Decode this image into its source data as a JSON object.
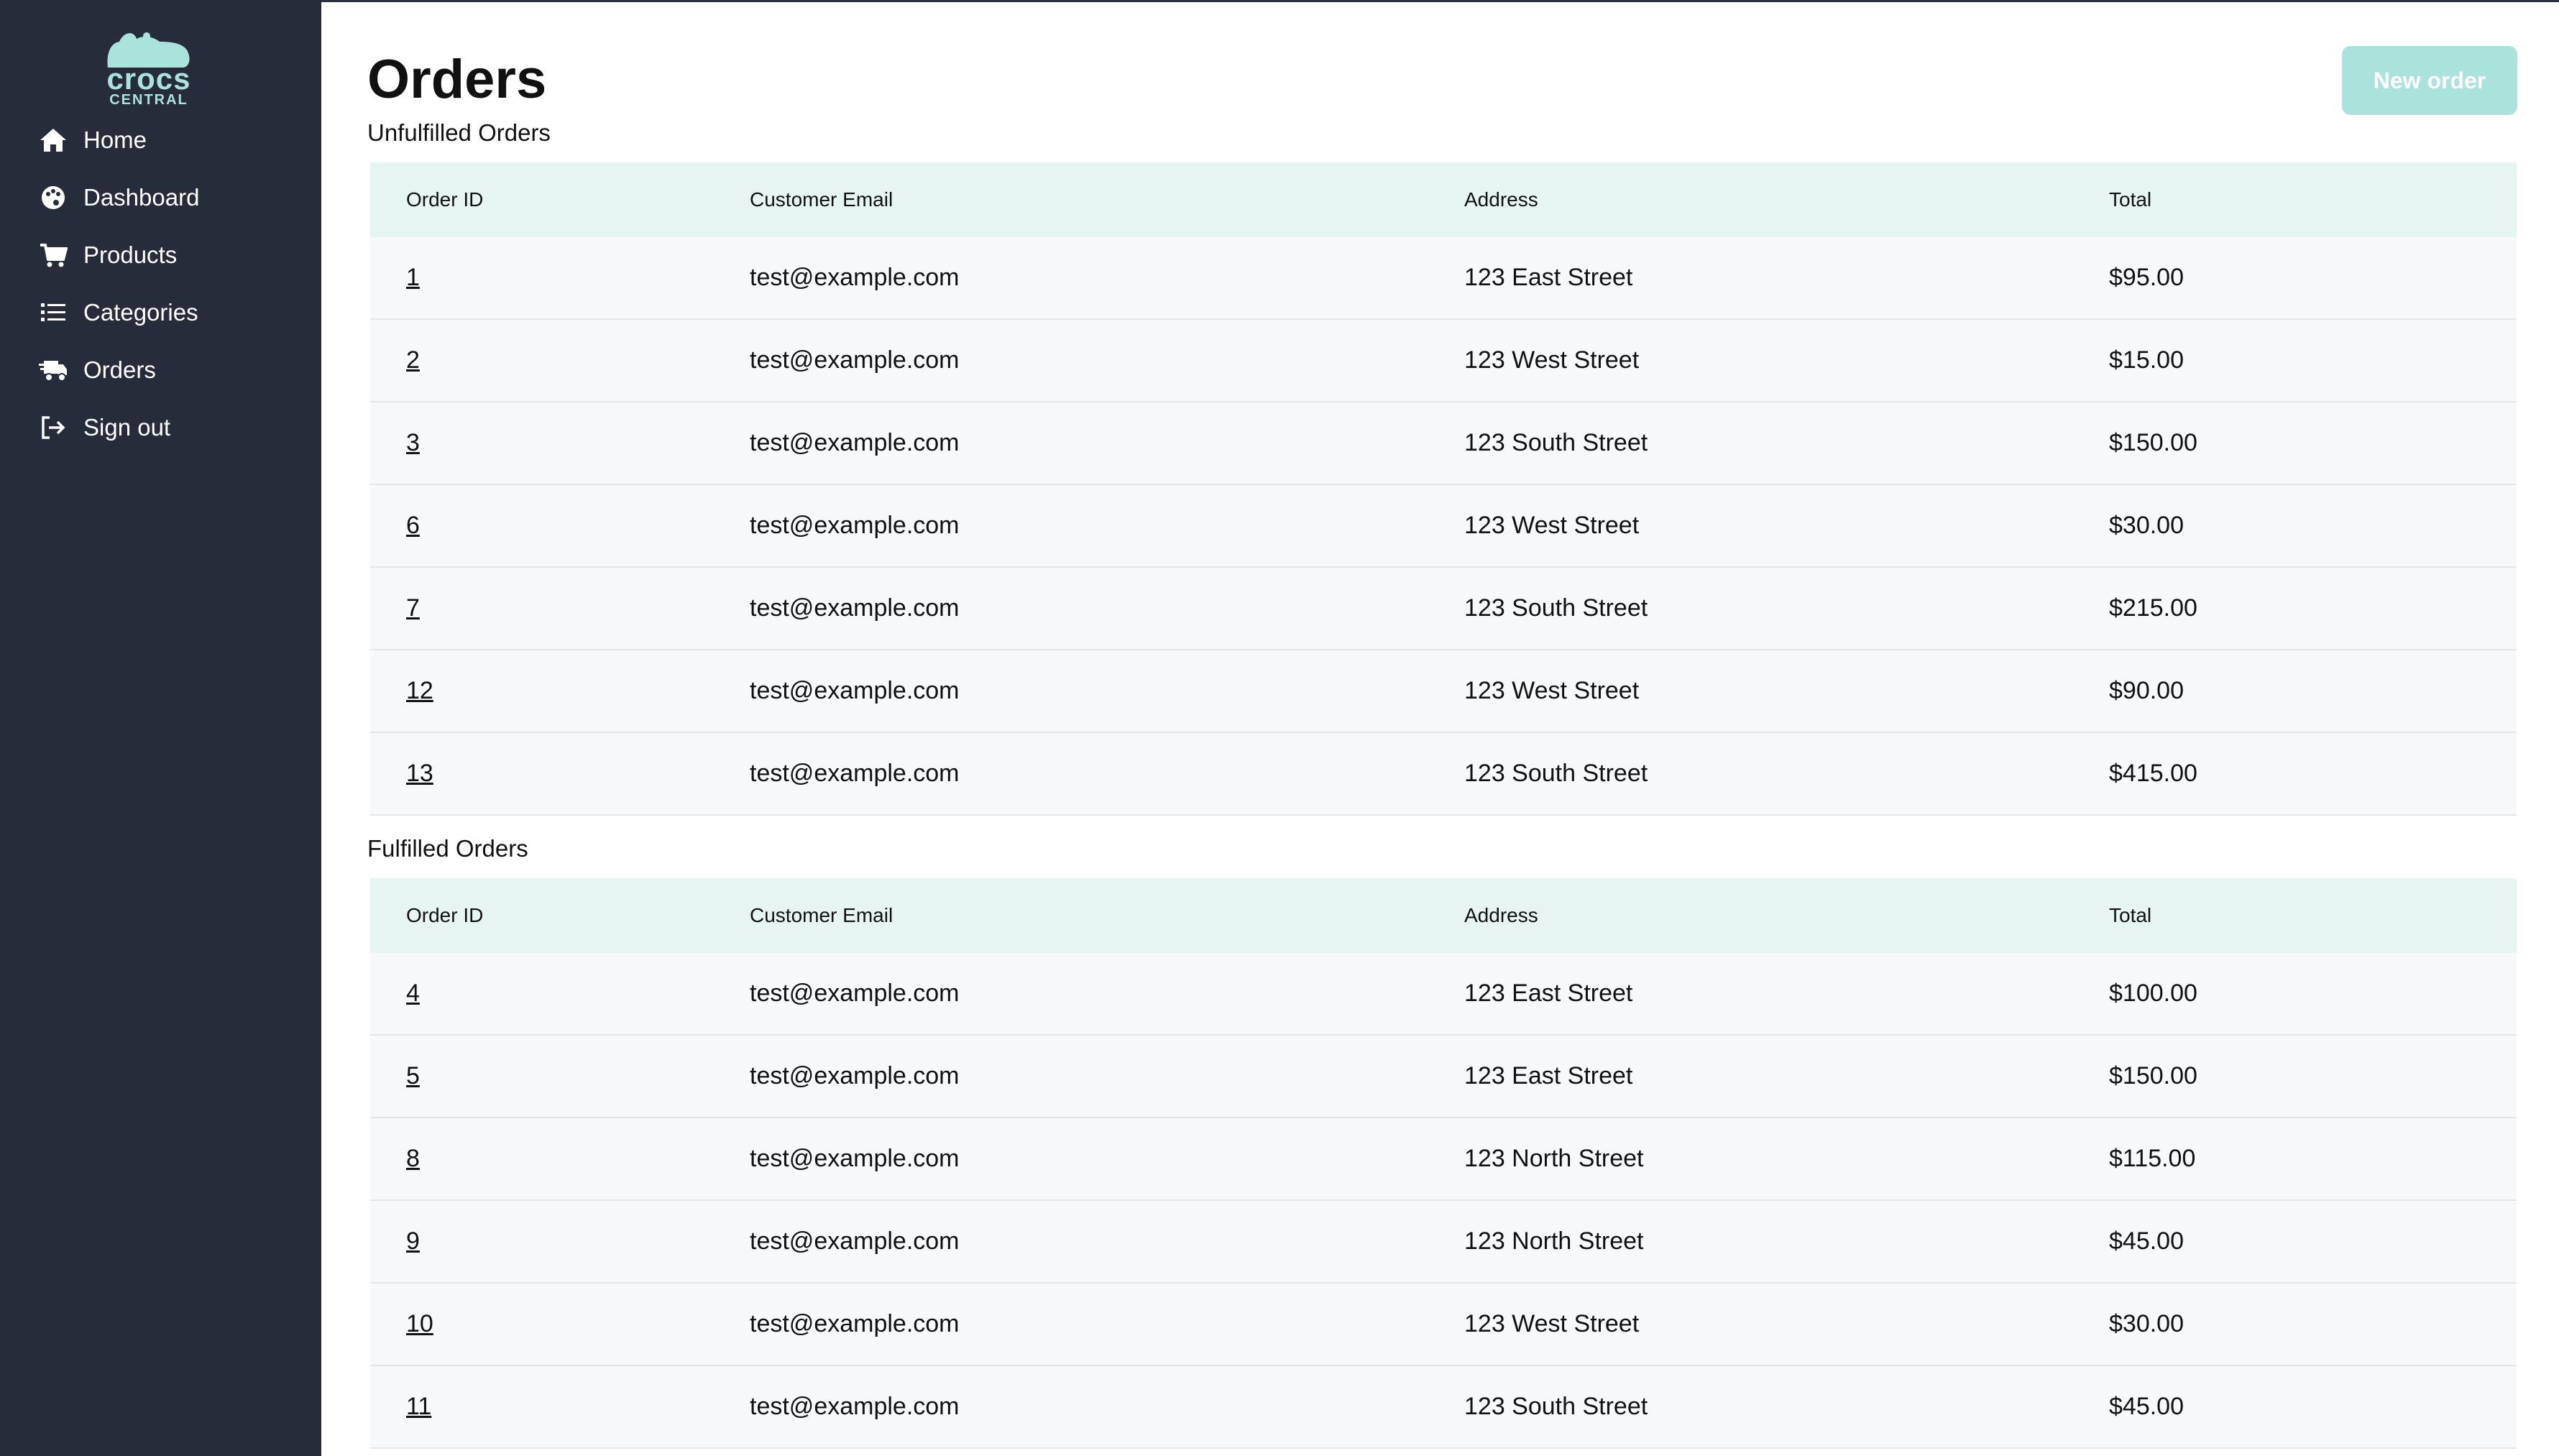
{
  "app": {
    "logo_text": "crocs",
    "logo_subtext": "CENTRAL"
  },
  "sidebar": {
    "items": [
      {
        "label": "Home",
        "icon": "home-icon"
      },
      {
        "label": "Dashboard",
        "icon": "palette-icon"
      },
      {
        "label": "Products",
        "icon": "cart-icon"
      },
      {
        "label": "Categories",
        "icon": "list-icon"
      },
      {
        "label": "Orders",
        "icon": "truck-icon"
      },
      {
        "label": "Sign out",
        "icon": "sign-out-icon"
      }
    ]
  },
  "page": {
    "title": "Orders",
    "new_order_label": "New order"
  },
  "columns": [
    "Order ID",
    "Customer Email",
    "Address",
    "Total"
  ],
  "unfulfilled": {
    "label": "Unfulfilled Orders",
    "rows": [
      [
        "1",
        "test@example.com",
        "123 East Street",
        "$95.00"
      ],
      [
        "2",
        "test@example.com",
        "123 West Street",
        "$15.00"
      ],
      [
        "3",
        "test@example.com",
        "123 South Street",
        "$150.00"
      ],
      [
        "6",
        "test@example.com",
        "123 West Street",
        "$30.00"
      ],
      [
        "7",
        "test@example.com",
        "123 South Street",
        "$215.00"
      ],
      [
        "12",
        "test@example.com",
        "123 West Street",
        "$90.00"
      ],
      [
        "13",
        "test@example.com",
        "123 South Street",
        "$415.00"
      ]
    ]
  },
  "fulfilled": {
    "label": "Fulfilled Orders",
    "rows": [
      [
        "4",
        "test@example.com",
        "123 East Street",
        "$100.00"
      ],
      [
        "5",
        "test@example.com",
        "123 East Street",
        "$150.00"
      ],
      [
        "8",
        "test@example.com",
        "123 North Street",
        "$115.00"
      ],
      [
        "9",
        "test@example.com",
        "123 North Street",
        "$45.00"
      ],
      [
        "10",
        "test@example.com",
        "123 West Street",
        "$30.00"
      ],
      [
        "11",
        "test@example.com",
        "123 South Street",
        "$45.00"
      ]
    ]
  },
  "colors": {
    "sidebar_bg": "#262c3a",
    "accent": "#a9e3dc",
    "table_header_bg": "#e6f4f2",
    "row_bg": "#f7f8fa"
  }
}
